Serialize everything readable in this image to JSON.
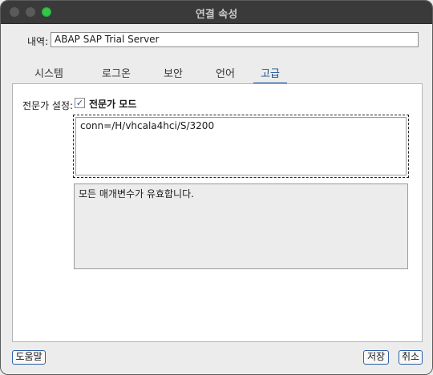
{
  "window": {
    "title": "연결 속성"
  },
  "description": {
    "label": "내역:",
    "value": "ABAP SAP Trial Server"
  },
  "tabs": [
    {
      "label": "시스템"
    },
    {
      "label": "로그온"
    },
    {
      "label": "보안"
    },
    {
      "label": "언어"
    },
    {
      "label": "고급",
      "active": true
    }
  ],
  "advanced": {
    "expert_settings_label": "전문가 설정:",
    "expert_mode_label": "전문가 모드",
    "expert_mode_checked": true,
    "connection_string": "conn=/H/vhcala4hci/S/3200",
    "status_message": "모든 매개변수가 유효합니다."
  },
  "buttons": {
    "help": "도움말",
    "save": "저장",
    "cancel": "취소"
  },
  "colors": {
    "accent": "#1d4f91",
    "titlebar": "#3a3a3a",
    "maximize": "#32c748"
  }
}
